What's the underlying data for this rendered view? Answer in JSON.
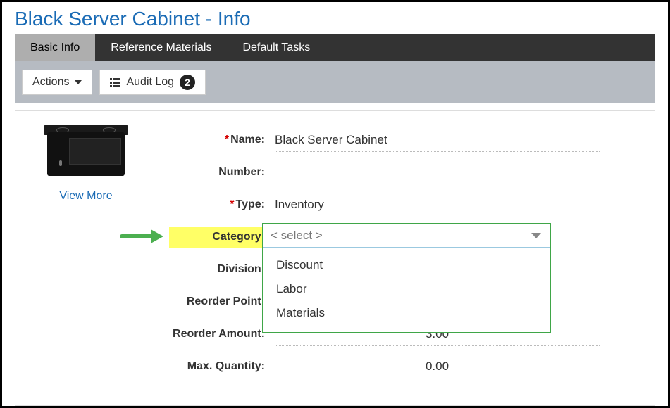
{
  "title": "Black Server Cabinet - Info",
  "tabs": {
    "basic": "Basic Info",
    "ref": "Reference Materials",
    "tasks": "Default Tasks"
  },
  "toolbar": {
    "actions": "Actions",
    "audit_log": "Audit Log",
    "audit_count": "2"
  },
  "thumb": {
    "view_more": "View More"
  },
  "labels": {
    "name": "Name:",
    "number": "Number:",
    "type": "Type:",
    "category": "Category:",
    "division": "Division:",
    "reorder_point": "Reorder Point:",
    "reorder_amount": "Reorder Amount:",
    "max_qty": "Max. Quantity:"
  },
  "values": {
    "name": "Black Server Cabinet",
    "number": "",
    "type": "Inventory",
    "division": "",
    "reorder_point": "",
    "reorder_amount": "3.00",
    "max_qty": "0.00"
  },
  "category_select": {
    "placeholder": "< select >",
    "options": {
      "discount": "Discount",
      "labor": "Labor",
      "materials": "Materials"
    }
  },
  "required_marker": "*"
}
